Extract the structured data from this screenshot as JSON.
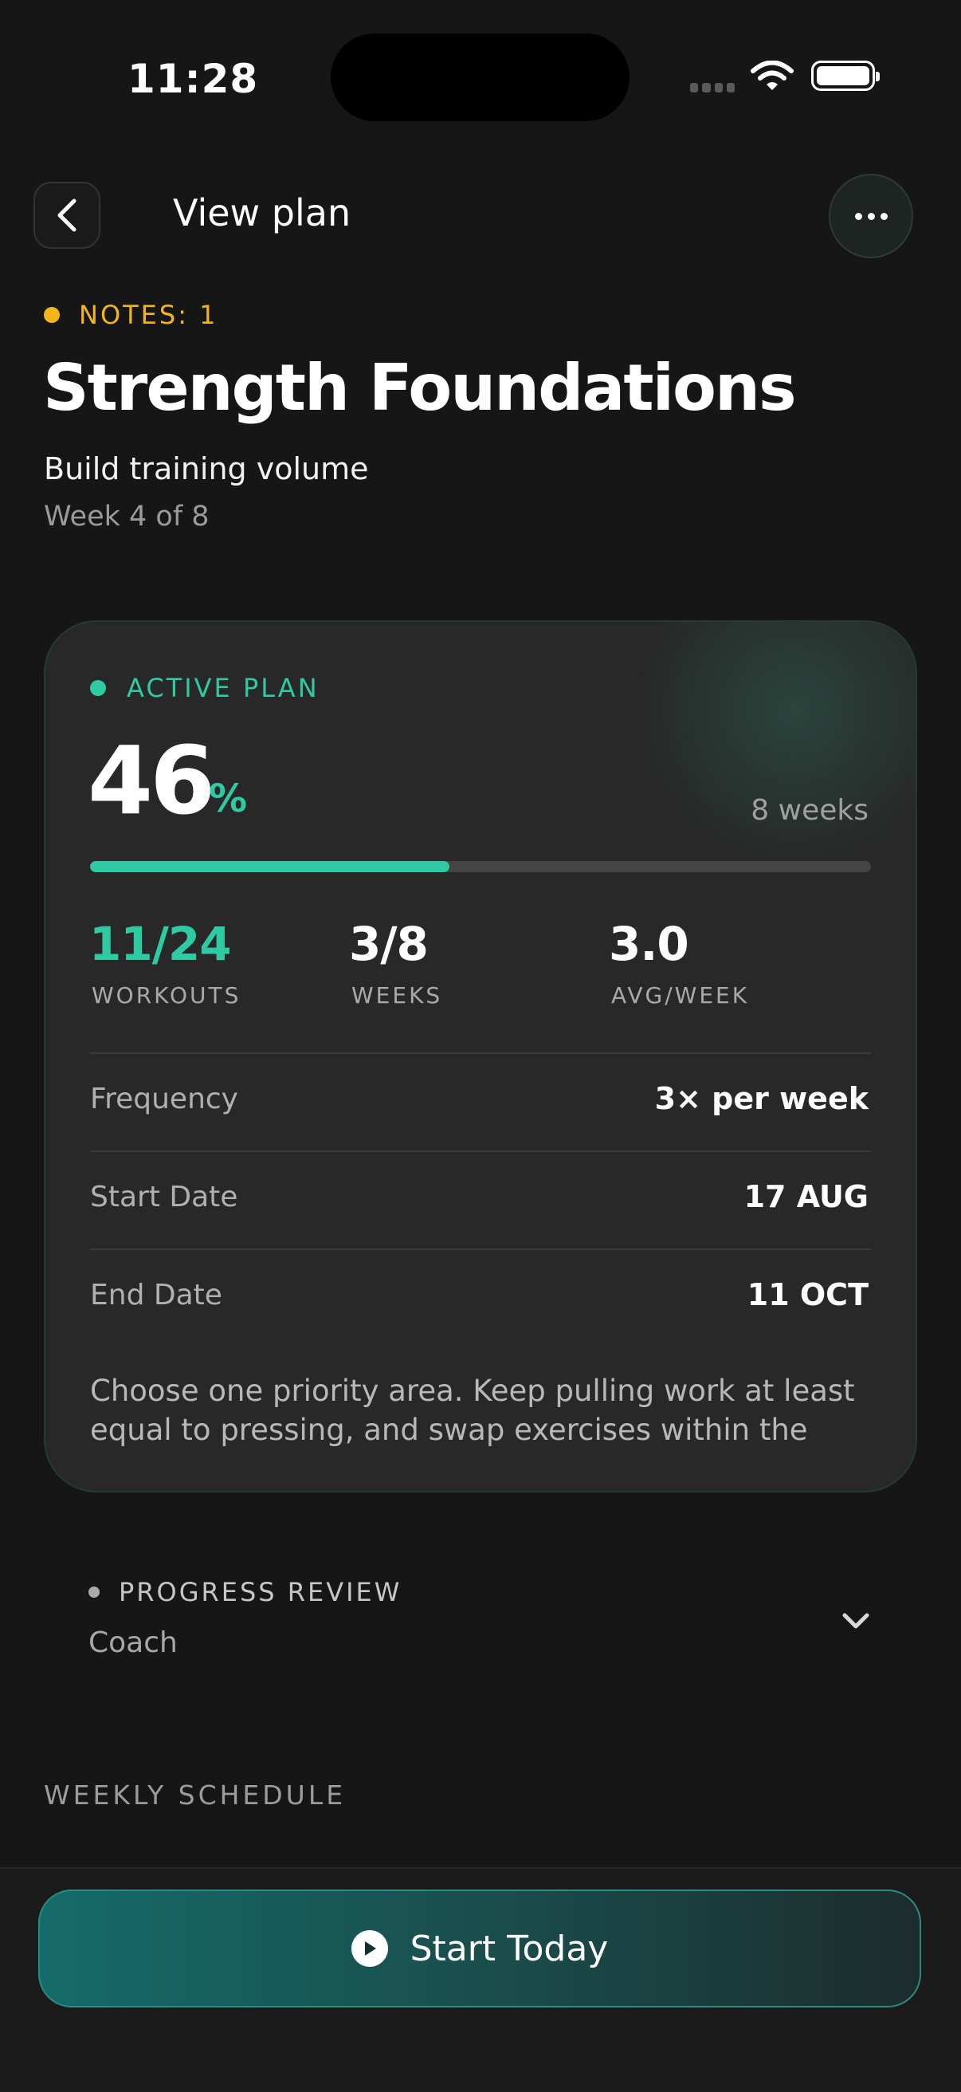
{
  "status_bar": {
    "time": "11:28"
  },
  "header": {
    "title": "View plan"
  },
  "notes": {
    "label": "NOTES: 1"
  },
  "plan": {
    "title": "Strength Foundations",
    "subtitle": "Build training volume",
    "week": "Week 4 of 8"
  },
  "card": {
    "status": "ACTIVE PLAN",
    "progress_value": "46",
    "progress_unit": "%",
    "progress_fraction": 0.46,
    "duration": "8 weeks",
    "stats": [
      {
        "value": "11/24",
        "label": "WORKOUTS"
      },
      {
        "value": "3/8",
        "label": "WEEKS"
      },
      {
        "value": "3.0",
        "label": "AVG/WEEK"
      }
    ],
    "rows": [
      {
        "label": "Frequency",
        "value": "3× per week"
      },
      {
        "label": "Start Date",
        "value": "17 AUG"
      },
      {
        "label": "End Date",
        "value": "11 OCT"
      }
    ],
    "description": "Choose one priority area. Keep pulling work at least equal to pressing, and swap exercises within the"
  },
  "review": {
    "title": "PROGRESS REVIEW",
    "author": "Coach"
  },
  "schedule": {
    "title": "WEEKLY SCHEDULE"
  },
  "cta": {
    "label": "Start Today"
  },
  "colors": {
    "accent": "#2fc9a4",
    "notes": "#f3b51a",
    "background": "#161616"
  }
}
